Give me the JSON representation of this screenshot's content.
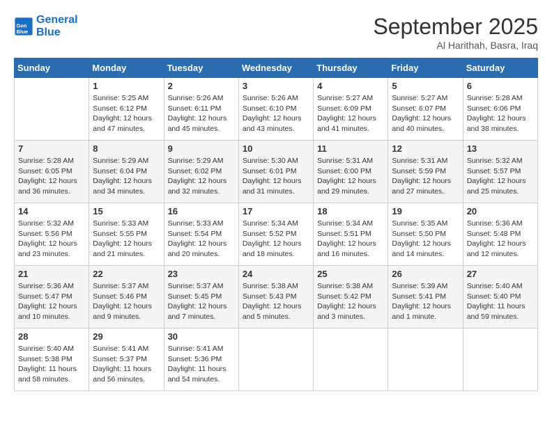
{
  "header": {
    "logo_line1": "General",
    "logo_line2": "Blue",
    "month": "September 2025",
    "location": "Al Harithah, Basra, Iraq"
  },
  "days_of_week": [
    "Sunday",
    "Monday",
    "Tuesday",
    "Wednesday",
    "Thursday",
    "Friday",
    "Saturday"
  ],
  "weeks": [
    [
      {
        "day": "",
        "info": ""
      },
      {
        "day": "1",
        "info": "Sunrise: 5:25 AM\nSunset: 6:12 PM\nDaylight: 12 hours\nand 47 minutes."
      },
      {
        "day": "2",
        "info": "Sunrise: 5:26 AM\nSunset: 6:11 PM\nDaylight: 12 hours\nand 45 minutes."
      },
      {
        "day": "3",
        "info": "Sunrise: 5:26 AM\nSunset: 6:10 PM\nDaylight: 12 hours\nand 43 minutes."
      },
      {
        "day": "4",
        "info": "Sunrise: 5:27 AM\nSunset: 6:09 PM\nDaylight: 12 hours\nand 41 minutes."
      },
      {
        "day": "5",
        "info": "Sunrise: 5:27 AM\nSunset: 6:07 PM\nDaylight: 12 hours\nand 40 minutes."
      },
      {
        "day": "6",
        "info": "Sunrise: 5:28 AM\nSunset: 6:06 PM\nDaylight: 12 hours\nand 38 minutes."
      }
    ],
    [
      {
        "day": "7",
        "info": "Sunrise: 5:28 AM\nSunset: 6:05 PM\nDaylight: 12 hours\nand 36 minutes."
      },
      {
        "day": "8",
        "info": "Sunrise: 5:29 AM\nSunset: 6:04 PM\nDaylight: 12 hours\nand 34 minutes."
      },
      {
        "day": "9",
        "info": "Sunrise: 5:29 AM\nSunset: 6:02 PM\nDaylight: 12 hours\nand 32 minutes."
      },
      {
        "day": "10",
        "info": "Sunrise: 5:30 AM\nSunset: 6:01 PM\nDaylight: 12 hours\nand 31 minutes."
      },
      {
        "day": "11",
        "info": "Sunrise: 5:31 AM\nSunset: 6:00 PM\nDaylight: 12 hours\nand 29 minutes."
      },
      {
        "day": "12",
        "info": "Sunrise: 5:31 AM\nSunset: 5:59 PM\nDaylight: 12 hours\nand 27 minutes."
      },
      {
        "day": "13",
        "info": "Sunrise: 5:32 AM\nSunset: 5:57 PM\nDaylight: 12 hours\nand 25 minutes."
      }
    ],
    [
      {
        "day": "14",
        "info": "Sunrise: 5:32 AM\nSunset: 5:56 PM\nDaylight: 12 hours\nand 23 minutes."
      },
      {
        "day": "15",
        "info": "Sunrise: 5:33 AM\nSunset: 5:55 PM\nDaylight: 12 hours\nand 21 minutes."
      },
      {
        "day": "16",
        "info": "Sunrise: 5:33 AM\nSunset: 5:54 PM\nDaylight: 12 hours\nand 20 minutes."
      },
      {
        "day": "17",
        "info": "Sunrise: 5:34 AM\nSunset: 5:52 PM\nDaylight: 12 hours\nand 18 minutes."
      },
      {
        "day": "18",
        "info": "Sunrise: 5:34 AM\nSunset: 5:51 PM\nDaylight: 12 hours\nand 16 minutes."
      },
      {
        "day": "19",
        "info": "Sunrise: 5:35 AM\nSunset: 5:50 PM\nDaylight: 12 hours\nand 14 minutes."
      },
      {
        "day": "20",
        "info": "Sunrise: 5:36 AM\nSunset: 5:48 PM\nDaylight: 12 hours\nand 12 minutes."
      }
    ],
    [
      {
        "day": "21",
        "info": "Sunrise: 5:36 AM\nSunset: 5:47 PM\nDaylight: 12 hours\nand 10 minutes."
      },
      {
        "day": "22",
        "info": "Sunrise: 5:37 AM\nSunset: 5:46 PM\nDaylight: 12 hours\nand 9 minutes."
      },
      {
        "day": "23",
        "info": "Sunrise: 5:37 AM\nSunset: 5:45 PM\nDaylight: 12 hours\nand 7 minutes."
      },
      {
        "day": "24",
        "info": "Sunrise: 5:38 AM\nSunset: 5:43 PM\nDaylight: 12 hours\nand 5 minutes."
      },
      {
        "day": "25",
        "info": "Sunrise: 5:38 AM\nSunset: 5:42 PM\nDaylight: 12 hours\nand 3 minutes."
      },
      {
        "day": "26",
        "info": "Sunrise: 5:39 AM\nSunset: 5:41 PM\nDaylight: 12 hours\nand 1 minute."
      },
      {
        "day": "27",
        "info": "Sunrise: 5:40 AM\nSunset: 5:40 PM\nDaylight: 11 hours\nand 59 minutes."
      }
    ],
    [
      {
        "day": "28",
        "info": "Sunrise: 5:40 AM\nSunset: 5:38 PM\nDaylight: 11 hours\nand 58 minutes."
      },
      {
        "day": "29",
        "info": "Sunrise: 5:41 AM\nSunset: 5:37 PM\nDaylight: 11 hours\nand 56 minutes."
      },
      {
        "day": "30",
        "info": "Sunrise: 5:41 AM\nSunset: 5:36 PM\nDaylight: 11 hours\nand 54 minutes."
      },
      {
        "day": "",
        "info": ""
      },
      {
        "day": "",
        "info": ""
      },
      {
        "day": "",
        "info": ""
      },
      {
        "day": "",
        "info": ""
      }
    ]
  ]
}
